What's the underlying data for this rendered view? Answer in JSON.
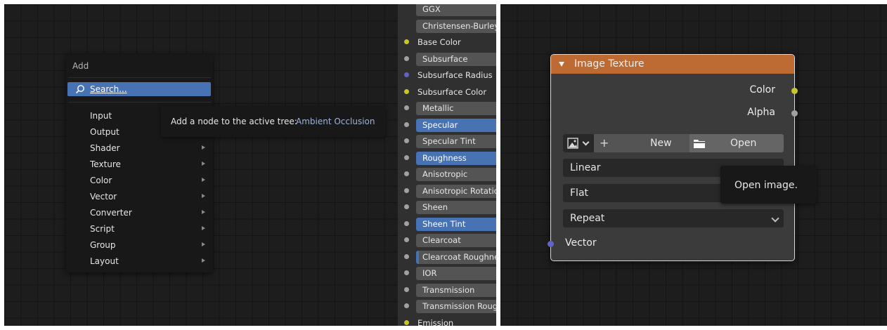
{
  "add_menu": {
    "title": "Add",
    "search_label": "Search...",
    "items": [
      {
        "label": "Input"
      },
      {
        "label": "Output"
      },
      {
        "label": "Shader"
      },
      {
        "label": "Texture"
      },
      {
        "label": "Color"
      },
      {
        "label": "Vector"
      },
      {
        "label": "Converter"
      },
      {
        "label": "Script"
      },
      {
        "label": "Group"
      },
      {
        "label": "Layout"
      }
    ]
  },
  "tooltip_add": {
    "text": "Add a node to the active tree:",
    "node_name": "Ambient Occlusion"
  },
  "shader_props": [
    {
      "label": "GGX",
      "style": "field",
      "socket": "none"
    },
    {
      "label": "Christensen-Burley",
      "style": "field",
      "socket": "none"
    },
    {
      "label": "Base Color",
      "style": "plain",
      "socket": "yellow"
    },
    {
      "label": "Subsurface",
      "style": "field",
      "socket": "grey"
    },
    {
      "label": "Subsurface Radius",
      "style": "plain",
      "socket": "purple"
    },
    {
      "label": "Subsurface Color",
      "style": "plain",
      "socket": "yellow"
    },
    {
      "label": "Metallic",
      "style": "field",
      "socket": "grey"
    },
    {
      "label": "Specular",
      "style": "blue",
      "socket": "grey"
    },
    {
      "label": "Specular Tint",
      "style": "field",
      "socket": "grey"
    },
    {
      "label": "Roughness",
      "style": "blue",
      "socket": "grey"
    },
    {
      "label": "Anisotropic",
      "style": "field",
      "socket": "grey"
    },
    {
      "label": "Anisotropic Rotation",
      "style": "field",
      "socket": "grey"
    },
    {
      "label": "Sheen",
      "style": "field",
      "socket": "grey"
    },
    {
      "label": "Sheen Tint",
      "style": "blue",
      "socket": "grey"
    },
    {
      "label": "Clearcoat",
      "style": "field",
      "socket": "grey"
    },
    {
      "label": "Clearcoat Roughness",
      "style": "partial",
      "socket": "grey"
    },
    {
      "label": "IOR",
      "style": "field",
      "socket": "grey"
    },
    {
      "label": "Transmission",
      "style": "field",
      "socket": "grey"
    },
    {
      "label": "Transmission Roughness",
      "style": "field",
      "socket": "grey"
    },
    {
      "label": "Emission",
      "style": "plain",
      "socket": "yellow"
    }
  ],
  "image_texture_node": {
    "title": "Image Texture",
    "outputs": [
      {
        "label": "Color",
        "socket_color": "#c7c729"
      },
      {
        "label": "Alpha",
        "socket_color": "#a1a1a1"
      }
    ],
    "new_label": "New",
    "open_label": "Open",
    "interpolation": "Linear",
    "projection": "Flat",
    "extension": "Repeat",
    "input_label": "Vector",
    "input_socket_color": "#6363c7",
    "header_color": "#be6a33"
  },
  "tooltip_open": {
    "text": "Open image."
  },
  "colors": {
    "selection_blue": "#4772b3",
    "socket_yellow": "#c7c729",
    "socket_grey": "#a1a1a1",
    "socket_purple": "#6363c7"
  }
}
